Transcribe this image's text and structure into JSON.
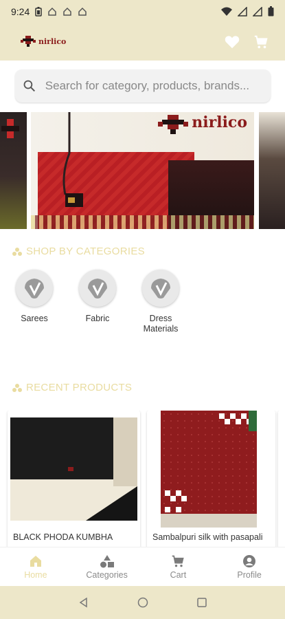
{
  "status_bar": {
    "time": "9:24",
    "icons": [
      "battery-saver-icon",
      "home-icon",
      "home-icon",
      "home-icon",
      "wifi-icon",
      "signal-icon",
      "signal-icon",
      "battery-icon"
    ]
  },
  "app_bar": {
    "logo_text": "nirlico",
    "actions": [
      "heart-icon",
      "cart-icon"
    ]
  },
  "search": {
    "placeholder": "Search for category, products, brands..."
  },
  "banner": {
    "brand_text": "nirlico"
  },
  "categories_section": {
    "title": "SHOP BY CATEGORIES",
    "items": [
      {
        "label": "Sarees"
      },
      {
        "label": "Fabric"
      },
      {
        "label": "Dress\nMaterials"
      }
    ]
  },
  "recent_section": {
    "title": "RECENT PRODUCTS",
    "items": [
      {
        "name": "BLACK PHODA KUMBHA"
      },
      {
        "name": "Sambalpuri silk with pasapali"
      }
    ]
  },
  "bottom_nav": {
    "items": [
      {
        "label": "Home",
        "icon": "home-icon",
        "active": true
      },
      {
        "label": "Categories",
        "icon": "categories-icon",
        "active": false
      },
      {
        "label": "Cart",
        "icon": "cart-icon",
        "active": false
      },
      {
        "label": "Profile",
        "icon": "profile-icon",
        "active": false
      }
    ]
  },
  "colors": {
    "accent": "#ede7c9",
    "section_title": "#e9dca0",
    "brand_red": "#8b1c1c"
  }
}
